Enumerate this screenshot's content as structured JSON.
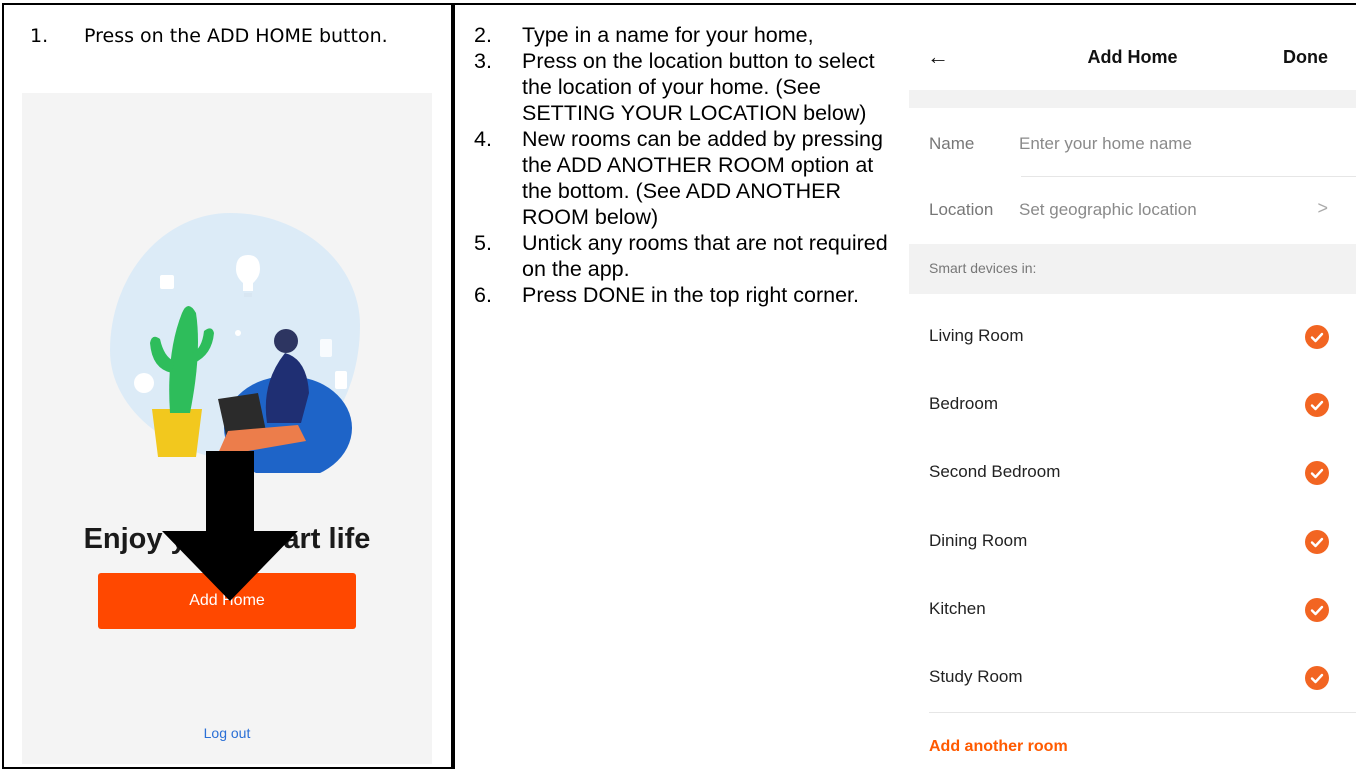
{
  "step1": {
    "number": "1.",
    "text": "Press on the ADD HOME button."
  },
  "phone1": {
    "tagline": "Enjoy your smart life",
    "add_home_label": "Add Home",
    "logout_label": "Log out"
  },
  "steps": [
    {
      "n": "2.",
      "text": "Type in a name for your home,"
    },
    {
      "n": "3.",
      "text": "Press on the location button to select the location of your home.  (See SETTING YOUR LOCATION below)"
    },
    {
      "n": "4.",
      "text": "New rooms can be added by pressing the ADD ANOTHER ROOM option at the bottom. (See ADD ANOTHER ROOM below)"
    },
    {
      "n": "5.",
      "text": "Untick any rooms that are not required on the app."
    },
    {
      "n": "6.",
      "text": "Press DONE in the top right corner."
    }
  ],
  "phone2": {
    "title": "Add Home",
    "done_label": "Done",
    "back_icon": "←",
    "name_label": "Name",
    "name_placeholder": "Enter your home name",
    "location_label": "Location",
    "location_value": "Set geographic location",
    "chevron_icon": ">",
    "smart_devices_label": "Smart devices in:",
    "rooms": [
      {
        "name": "Living Room",
        "checked": true
      },
      {
        "name": "Bedroom",
        "checked": true
      },
      {
        "name": "Second Bedroom",
        "checked": true
      },
      {
        "name": "Dining Room",
        "checked": true
      },
      {
        "name": "Kitchen",
        "checked": true
      },
      {
        "name": "Study Room",
        "checked": true
      }
    ],
    "add_room_label": "Add another room"
  },
  "colors": {
    "accent": "#ff4800",
    "check": "#f26522",
    "link": "#2a6fd6"
  }
}
